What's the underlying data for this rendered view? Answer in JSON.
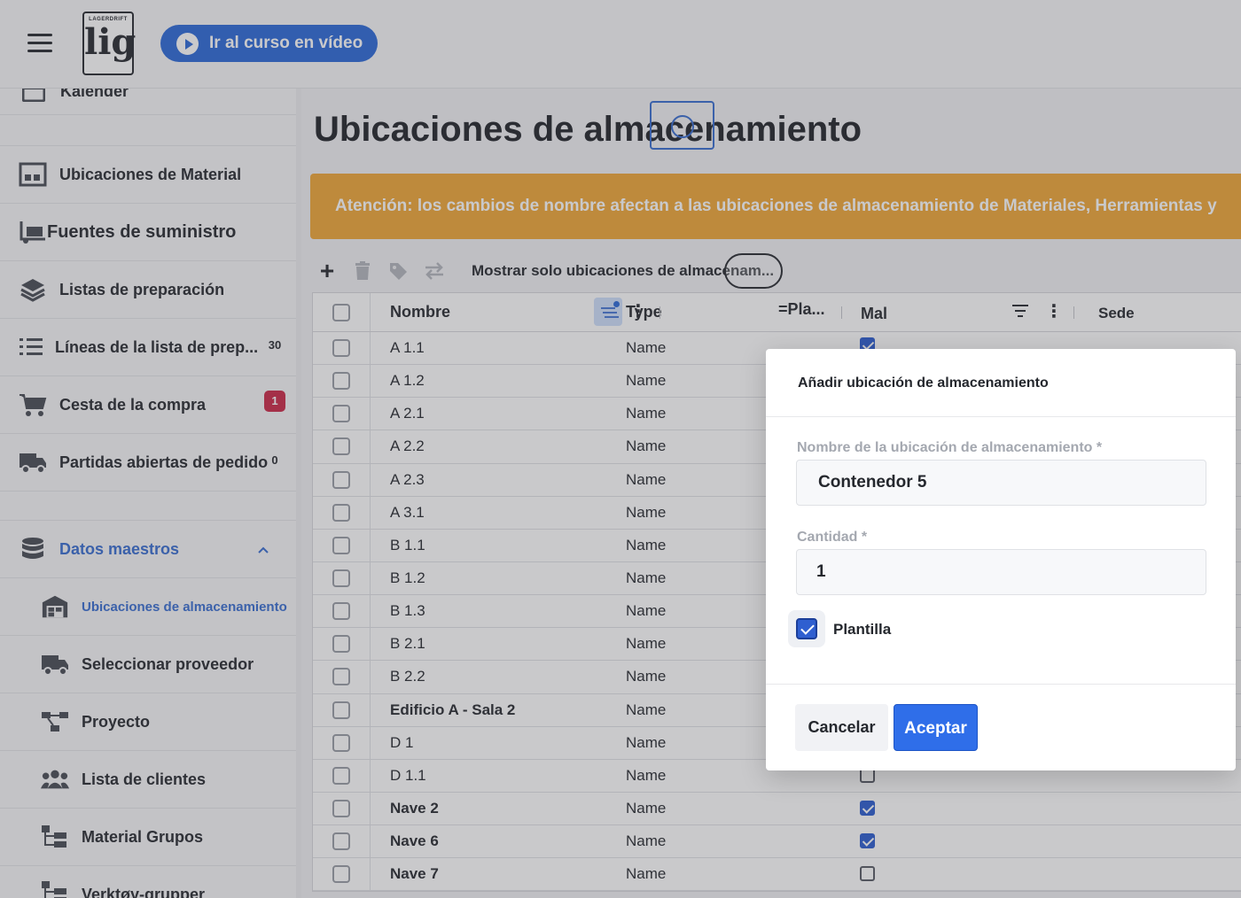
{
  "topbar": {
    "logo_small": "LAGERDRIFT",
    "logo_big": "lig",
    "video_button": "Ir al curso en vídeo"
  },
  "sidebar": {
    "items": [
      {
        "label": "Kalender",
        "icon": "calendar-icon"
      },
      {
        "label": "Ubicaciones de Material",
        "icon": "warehouse-icon"
      },
      {
        "label": "Fuentes de suministro",
        "icon": "dolly-icon"
      },
      {
        "label": "Listas de preparación",
        "icon": "layers-icon"
      },
      {
        "label": "Líneas de la lista de prep...",
        "icon": "list-icon",
        "badge": "30"
      },
      {
        "label": "Cesta de la compra",
        "icon": "cart-icon",
        "badge": "1"
      },
      {
        "label": "Partidas abiertas de pedido",
        "icon": "truck-icon",
        "badge": "0"
      },
      {
        "label": "Datos maestros",
        "icon": "database-icon"
      },
      {
        "label": "Ubicaciones de almacenamiento",
        "icon": "warehouse-icon"
      },
      {
        "label": "Seleccionar proveedor",
        "icon": "truck-icon"
      },
      {
        "label": "Proyecto",
        "icon": "project-icon"
      },
      {
        "label": "Lista de clientes",
        "icon": "users-icon"
      },
      {
        "label": "Material Grupos",
        "icon": "tree-icon"
      },
      {
        "label": "Verktøy-grupper",
        "icon": "tree-icon"
      }
    ]
  },
  "main": {
    "title": "Ubicaciones de almacenamiento",
    "warning": "Atención: los cambios de nombre afectan a las ubicaciones de almacenamiento de Materiales, Herramientas y",
    "toolbar": {
      "toggle_label": "Mostrar solo ubicaciones de almacenam..."
    },
    "columns": {
      "name": "Nombre",
      "type": "Type",
      "pla": "=Pla...",
      "mal": "Mal",
      "sede": "Sede"
    },
    "rows": [
      {
        "name": "A 1.1",
        "type": "Name",
        "mal": true
      },
      {
        "name": "A 1.2",
        "type": "Name"
      },
      {
        "name": "A 2.1",
        "type": "Name"
      },
      {
        "name": "A 2.2",
        "type": "Name"
      },
      {
        "name": "A 2.3",
        "type": "Name"
      },
      {
        "name": "A 3.1",
        "type": "Name"
      },
      {
        "name": "B 1.1",
        "type": "Name"
      },
      {
        "name": "B 1.2",
        "type": "Name"
      },
      {
        "name": "B 1.3",
        "type": "Name"
      },
      {
        "name": "B 2.1",
        "type": "Name"
      },
      {
        "name": "B 2.2",
        "type": "Name"
      },
      {
        "name": "Edificio A - Sala 2",
        "type": "Name"
      },
      {
        "name": "D 1",
        "type": "Name"
      },
      {
        "name": "D 1.1",
        "type": "Name",
        "mal": false
      },
      {
        "name": "Nave 2",
        "type": "Name",
        "mal": true
      },
      {
        "name": "Nave 6",
        "type": "Name",
        "mal": true
      },
      {
        "name": "Nave 7",
        "type": "Name",
        "mal": false
      }
    ]
  },
  "dialog": {
    "title": "Añadir ubicación de almacenamiento",
    "name_label": "Nombre de la ubicación de almacenamiento *",
    "name_value": "Contenedor 5",
    "qty_label": "Cantidad *",
    "qty_value": "1",
    "template_label": "Plantilla",
    "template_checked": true,
    "cancel": "Cancelar",
    "accept": "Aceptar"
  },
  "colors": {
    "accent": "#2f6bd8",
    "warning": "#f0a83a",
    "badge_red": "#cc2b4a"
  }
}
